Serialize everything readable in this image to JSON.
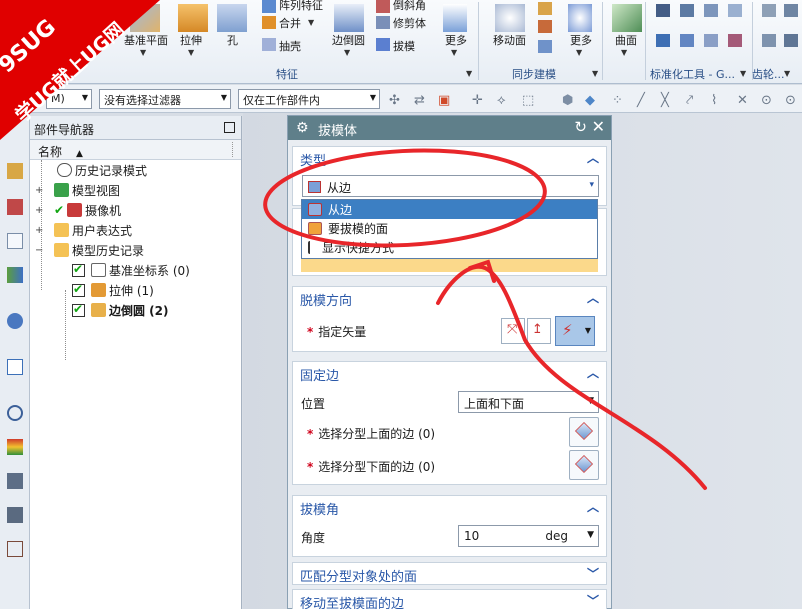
{
  "banner": {
    "line1": "9SUG",
    "line2": "学UG就上UG网"
  },
  "ribbon": {
    "row1": {
      "array_feature": "阵列特征",
      "combine": "合并",
      "shell": "抽壳",
      "draft_body": "倒斜角",
      "trim_body": "修剪体",
      "draft": "拔模"
    },
    "row2": {
      "datum_plane": "基准平面",
      "extrude": "拉伸",
      "hole": "孔",
      "edge_blend": "边倒圆",
      "more1": "更多",
      "move_face": "移动面",
      "more2": "更多",
      "surface": "曲面"
    },
    "groups": {
      "feature": "特征",
      "sync_modeling": "同步建模",
      "std_tools": "标准化工具 - G...",
      "gear": "齿轮..."
    }
  },
  "toolbar2": {
    "menu_fragment": "M)",
    "filter": "没有选择过滤器",
    "scope": "仅在工作部件内"
  },
  "navigator": {
    "title": "部件导航器",
    "column": "名称",
    "items": [
      {
        "label": "历史记录模式"
      },
      {
        "label": "模型视图"
      },
      {
        "label": "摄像机"
      },
      {
        "label": "用户表达式"
      },
      {
        "label": "模型历史记录"
      },
      {
        "label": "基准坐标系 (0)"
      },
      {
        "label": "拉伸 (1)"
      },
      {
        "label": "边倒圆 (2)"
      }
    ]
  },
  "dialog": {
    "title": "拔模体",
    "type_section": "类型",
    "type_value": "从边",
    "type_options": [
      "从边",
      "要拔模的面",
      "显示快捷方式"
    ],
    "pull_section": "脱模方向",
    "specify_vector": "指定矢量",
    "fixed_section": "固定边",
    "position_label": "位置",
    "position_value": "上面和下面",
    "select_upper": "选择分型上面的边 (0)",
    "select_lower": "选择分型下面的边 (0)",
    "angle_section": "拔模角",
    "angle_label": "角度",
    "angle_value": "10",
    "angle_unit": "deg",
    "match_section": "匹配分型对象处的面",
    "move_section": "移动至拔模面的边"
  },
  "colors": {
    "dialog_header": "#5f7f8a",
    "section_title": "#2a58a8",
    "selection": "#3c7fc3",
    "annotation": "#e8262a"
  }
}
